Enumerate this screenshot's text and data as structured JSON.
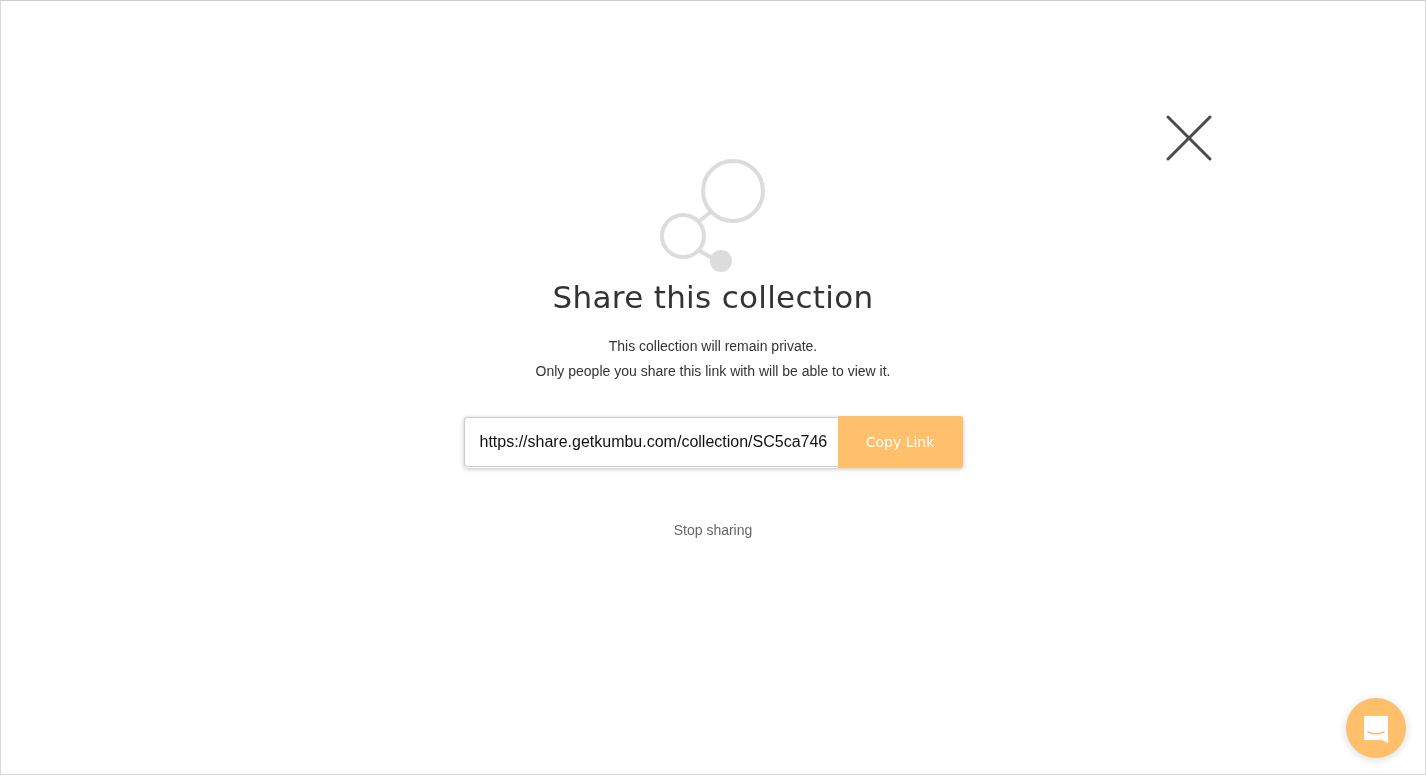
{
  "dialog": {
    "title": "Share this collection",
    "description": [
      "This collection will remain private.",
      "Only people you share this link with will be able to view it."
    ],
    "link_field": {
      "value": "https://share.getkumbu.com/collection/SC5ca746"
    },
    "copy_button": "Copy Link",
    "stop_link": "Stop sharing"
  }
}
